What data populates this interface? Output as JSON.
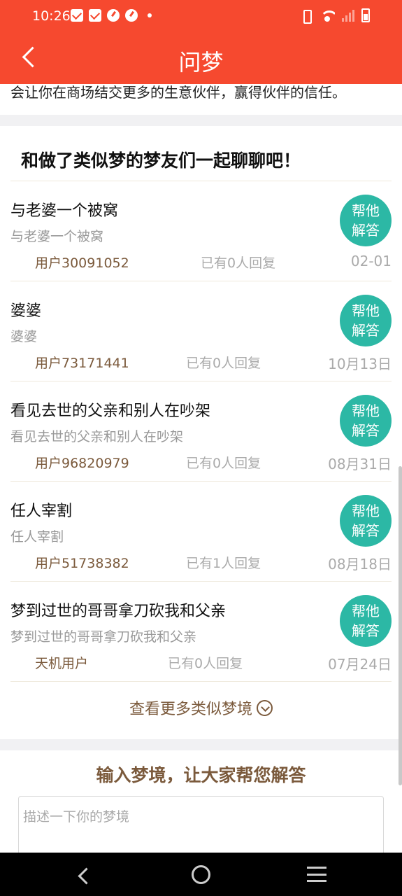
{
  "status_bar": {
    "time": "10:26"
  },
  "header": {
    "title": "问梦"
  },
  "top_snippet": "会让你在商场结交更多的生意伙伴，赢得伙伴的信任。",
  "section": {
    "title": "和做了类似梦的梦友们一起聊聊吧！",
    "help_button_line1": "帮他",
    "help_button_line2": "解答",
    "more_label": "查看更多类似梦境",
    "items": [
      {
        "title": "与老婆一个被窝",
        "desc": "与老婆一个被窝",
        "user": "用户30091052",
        "replies": "已有0人回复",
        "date": "02-01"
      },
      {
        "title": "婆婆",
        "desc": "婆婆",
        "user": "用户73171441",
        "replies": "已有0人回复",
        "date": "10月13日"
      },
      {
        "title": "看见去世的父亲和别人在吵架",
        "desc": "看见去世的父亲和别人在吵架",
        "user": "用户96820979",
        "replies": "已有0人回复",
        "date": "08月31日"
      },
      {
        "title": "任人宰割",
        "desc": "任人宰割",
        "user": "用户51738382",
        "replies": "已有1人回复",
        "date": "08月18日"
      },
      {
        "title": "梦到过世的哥哥拿刀砍我和父亲",
        "desc": "梦到过世的哥哥拿刀砍我和父亲",
        "user": "天机用户",
        "replies": "已有0人回复",
        "date": "07月24日"
      }
    ]
  },
  "input_section": {
    "heading": "输入梦境，让大家帮您解答",
    "placeholder": "描述一下你的梦境"
  },
  "colors": {
    "header": "#f6492f",
    "accent_teal": "#2cb8a5",
    "brown": "#7b5a3c"
  },
  "icons": [
    "mail-icon",
    "compass-icon",
    "vibrate-icon",
    "wifi-icon",
    "signal-icon",
    "battery-icon",
    "back-icon",
    "chevron-down-icon"
  ]
}
